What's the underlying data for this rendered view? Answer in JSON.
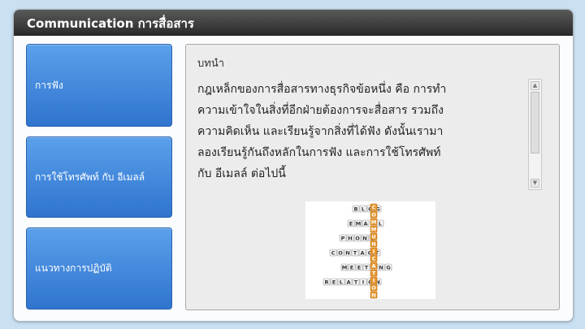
{
  "header": {
    "title": "Communication การสื่อสาร"
  },
  "nav": {
    "items": [
      {
        "label": "การฟัง"
      },
      {
        "label": "การใช้โทรศัพท์ กับ อีเมลล์"
      },
      {
        "label": "แนวทางการปฏิบัติ"
      }
    ]
  },
  "content": {
    "heading": "บทนำ",
    "body_lines": [
      "กฎเหล็กของการสื่อสารทางธุรกิจข้อหนึ่ง คือ การทำ",
      "ความเข้าใจในสิ่งที่อีกฝ่ายต้องการจะสื่อสาร รวมถึง",
      "ความคิดเห็น และเรียนรู้จากสิ่งที่ได้ฟัง  ดังนั้นเรามา",
      "ลองเรียนรู้กันถึงหลักในการฟัง และการใช้โทรศัพท์",
      "กับ อีเมลล์ ต่อไปนี้"
    ],
    "image_words": {
      "horizontal": [
        "BLOG",
        "EMAIL",
        "PHONE",
        "CONTACT",
        "MEETING",
        "RELATION"
      ],
      "vertical": "COMMUNICATION"
    }
  },
  "colors": {
    "page_bg": "#c9e1f2",
    "nav_button": "#3b82d8",
    "highlight_tile": "#e8972c"
  }
}
